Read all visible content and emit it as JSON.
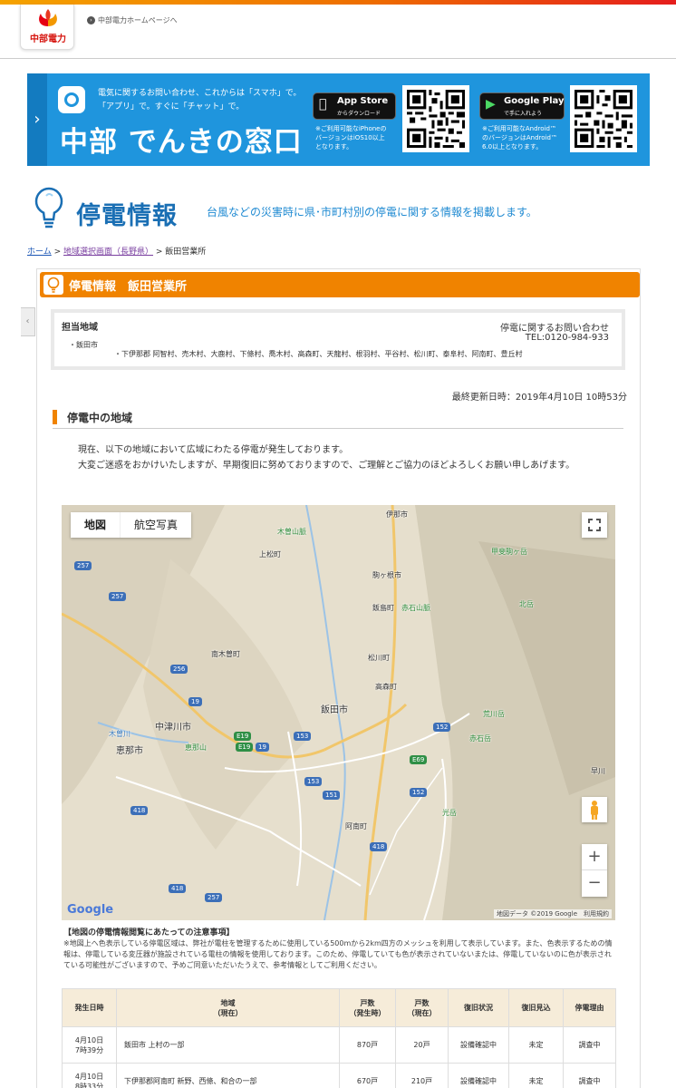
{
  "header": {
    "logo_text": "中部電力",
    "home_link": "中部電力ホームページへ"
  },
  "banner": {
    "tagline": "電気に関するお問い合わせ、これからは「スマホ」で。\n「アプリ」で。すぐに「チャット」で。",
    "title": "中部 でんきの窓口",
    "app_store": {
      "big": "App Store",
      "small": "からダウンロード",
      "note": "※ご利用可能なiPhoneの\nバージョンはiOS10以上\nとなります。"
    },
    "google_play": {
      "big": "Google Play",
      "small": "で手に入れよう",
      "note": "※ご利用可能なAndroid™\nのバージョンはAndroid™\n6.0以上となります。"
    }
  },
  "page": {
    "title": "停電情報",
    "subtitle": "台風などの災害時に県･市町村別の停電に関する情報を掲載します。"
  },
  "breadcrumb": {
    "home": "ホーム",
    "sep1": " > ",
    "region": "地域選択画面（長野県）",
    "sep2": " > ",
    "current": "飯田営業所"
  },
  "panel": {
    "title": "停電情報　飯田営業所"
  },
  "region": {
    "label": "担当地域",
    "city": "・飯田市",
    "towns": "・下伊那郡 阿智村、売木村、大鹿村、下條村、喬木村、高森町、天龍村、根羽村、平谷村、松川町、泰阜村、阿南町、豊丘村",
    "contact_label": "停電に関するお問い合わせ",
    "contact_tel": "TEL:0120-984-933"
  },
  "updated": "最終更新日時：2019年4月10日  10時53分",
  "section": {
    "title": "停電中の地域"
  },
  "notice": {
    "line1": "現在、以下の地域において広域にわたる停電が発生しております。",
    "line2": "大変ご迷惑をおかけいたしますが、早期復旧に努めておりますので、ご理解とご協力のほどよろしくお願い申しあげます。"
  },
  "map": {
    "tab_map": "地図",
    "tab_satellite": "航空写真",
    "zoom_in": "+",
    "zoom_out": "−",
    "google": "Google",
    "attribution": "地図データ ©2019 Google　利用規約",
    "places": {
      "ina": "伊那市",
      "kisosanmyaku": "木曽山脈",
      "agematsu": "上松町",
      "komagane": "駒ヶ根市",
      "kaikomagatake": "甲斐駒ヶ岳",
      "iijima": "飯島町",
      "akaishi": "赤石山脈",
      "kitadake": "北岳",
      "matsukawa": "松川町",
      "minamikiso": "南木曽町",
      "takamori": "高森町",
      "iida": "飯田市",
      "nakatsugawa": "中津川市",
      "arakawadake": "荒川岳",
      "kisogawa": "木曽川",
      "ena": "恵那市",
      "enasan": "恵那山",
      "akaishidake": "赤石岳",
      "hayakawa": "早川",
      "tekaridake": "光岳",
      "anan": "阿南町"
    },
    "routes": [
      "257",
      "257",
      "256",
      "19",
      "19",
      "E19",
      "E19",
      "153",
      "153",
      "151",
      "152",
      "152",
      "E69",
      "418",
      "418",
      "418",
      "257"
    ]
  },
  "caution": {
    "title": "【地図の停電情報閲覧にあたっての注意事項】",
    "text": "※地図上へ色表示している停電区域は、弊社が電柱を管理するために使用している500mから2km四方のメッシュを利用して表示しています。また、色表示するための情報は、停電している変圧器が施設されている電柱の情報を使用しております。このため、停電していても色が表示されていないまたは、停電していないのに色が表示されている可能性がございますので、予めご同意いただいたうえで、参考情報としてご利用ください。"
  },
  "table": {
    "headers": [
      "発生日時",
      "地域\n（現在）",
      "戸数\n（発生時）",
      "戸数\n（現在）",
      "復旧状況",
      "復旧見込",
      "停電理由"
    ],
    "rows": [
      [
        "4月10日\n7時39分",
        "飯田市 上村の一部",
        "870戸",
        "20戸",
        "設備確認中",
        "未定",
        "調査中"
      ],
      [
        "4月10日\n8時33分",
        "下伊那郡阿南町 新野、西條、和合の一部",
        "670戸",
        "210戸",
        "設備確認中",
        "未定",
        "調査中"
      ]
    ]
  },
  "colors": {
    "brand_orange": "#f08300",
    "banner_blue": "#1f95dd",
    "title_blue": "#1a6fb4"
  }
}
